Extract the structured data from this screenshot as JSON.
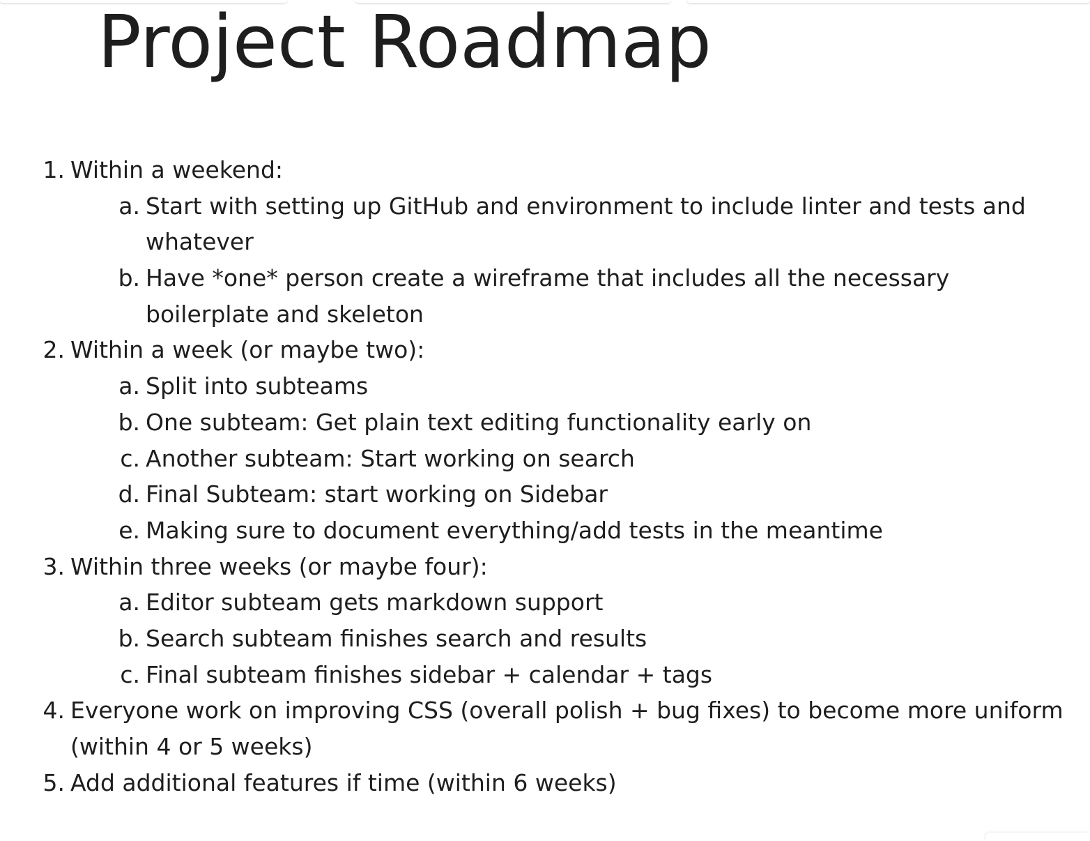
{
  "title": "Project Roadmap",
  "items": [
    {
      "marker": "1.",
      "text": "Within a weekend:",
      "subitems": [
        {
          "marker": "a.",
          "text": "Start with setting up GitHub and environment to include linter and tests and whatever"
        },
        {
          "marker": "b.",
          "text": "Have *one* person create a wireframe that includes all the necessary boilerplate and skeleton"
        }
      ]
    },
    {
      "marker": "2.",
      "text": "Within a week (or maybe two):",
      "subitems": [
        {
          "marker": "a.",
          "text": "Split into subteams"
        },
        {
          "marker": "b.",
          "text": "One subteam: Get plain text editing functionality early on"
        },
        {
          "marker": "c.",
          "text": "Another subteam: Start working on search"
        },
        {
          "marker": "d.",
          "text": "Final Subteam: start working on Sidebar"
        },
        {
          "marker": "e.",
          "text": "Making sure to document everything/add tests in the meantime"
        }
      ]
    },
    {
      "marker": "3.",
      "text": "Within three weeks (or maybe four):",
      "subitems": [
        {
          "marker": "a.",
          "text": "Editor subteam gets markdown support"
        },
        {
          "marker": "b.",
          "text": "Search subteam finishes search and results"
        },
        {
          "marker": "c.",
          "text": "Final subteam finishes sidebar + calendar + tags"
        }
      ]
    },
    {
      "marker": "4.",
      "text": "Everyone work on improving CSS (overall polish + bug fixes) to become more uniform (within 4 or 5 weeks)",
      "subitems": []
    },
    {
      "marker": "5.",
      "text": "Add additional features if time (within 6 weeks)",
      "subitems": []
    }
  ]
}
